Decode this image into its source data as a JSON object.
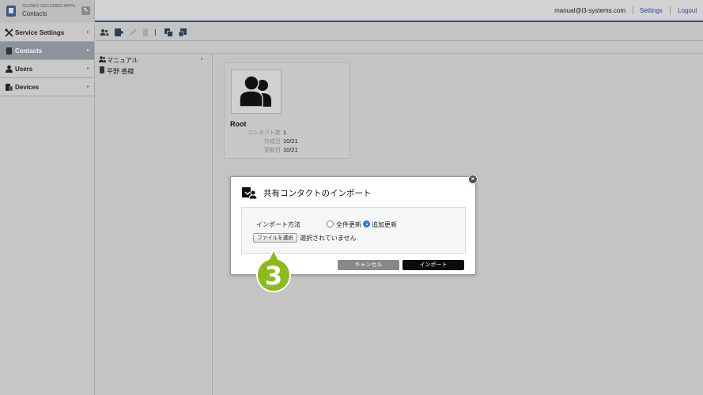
{
  "app": {
    "brand_sub": "CLOMO SECURED APPs",
    "brand_title": "Contacts",
    "brand_edit_icon": "edit-icon"
  },
  "header": {
    "user_email": "manual@i3-systems.com",
    "settings_label": "Settings",
    "logout_label": "Logout"
  },
  "sidebar": {
    "items": [
      {
        "label": "Service Settings",
        "icon": "tools-icon"
      },
      {
        "label": "Contacts",
        "icon": "contacts-book-icon",
        "active": true
      },
      {
        "label": "Users",
        "icon": "user-icon"
      },
      {
        "label": "Devices",
        "icon": "device-icon"
      }
    ]
  },
  "toolbar": {
    "buttons": [
      "add-user-icon",
      "add-contact-icon",
      "edit-pencil-icon",
      "trash-icon",
      "copy-contact-icon",
      "import-export-icon"
    ]
  },
  "tree": {
    "items": [
      {
        "label": "マニュアル",
        "icon": "group-icon"
      },
      {
        "label": "平野 香織",
        "icon": "contact-card-icon"
      }
    ]
  },
  "card": {
    "name": "Root",
    "rows": [
      {
        "key": "コンタクト数",
        "value": "1"
      },
      {
        "key": "作成日",
        "value": "10/21"
      },
      {
        "key": "更新日",
        "value": "10/21"
      }
    ]
  },
  "modal": {
    "title": "共有コンタクトのインポート",
    "method_label": "インポート方法",
    "option_full": "全件更新",
    "option_add": "追加更新",
    "selected_option": "追加更新",
    "file_button": "ファイルを選択",
    "file_status": "選択されていません",
    "cancel_label": "キャンセル",
    "import_label": "インポート"
  },
  "step_marker": {
    "number": "3",
    "color": "#8cba1e"
  }
}
